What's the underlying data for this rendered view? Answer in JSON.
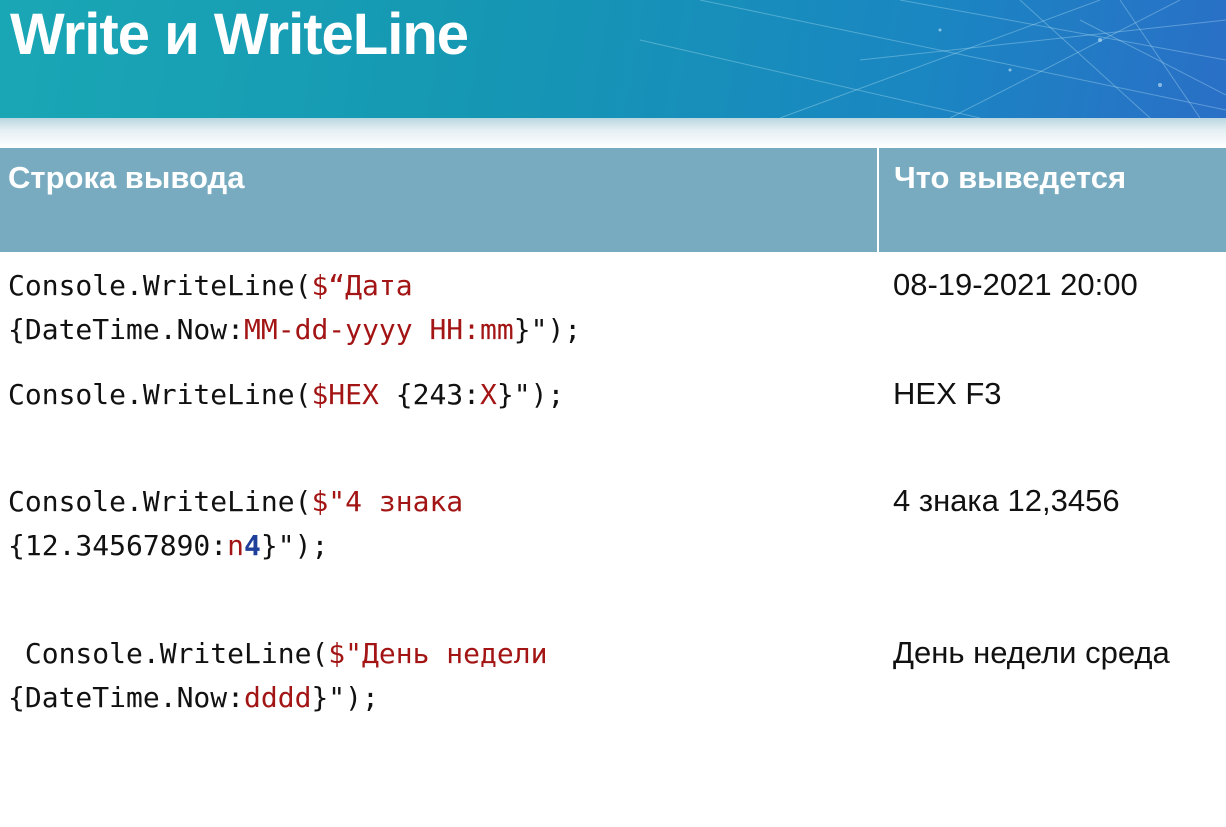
{
  "title": "Write и WriteLine",
  "table": {
    "headers": [
      "Строка вывода",
      "Что выведется"
    ],
    "rows": [
      {
        "code": [
          [
            {
              "t": "Console.WriteLine(",
              "c": ""
            },
            {
              "t": "$“Дата",
              "c": "r"
            }
          ],
          [
            {
              "t": "{DateTime.Now:",
              "c": ""
            },
            {
              "t": "MM-dd-yyyy HH:mm",
              "c": "r"
            },
            {
              "t": "}\");",
              "c": ""
            }
          ]
        ],
        "output": "08-19-2021 20:00"
      },
      {
        "code": [
          [
            {
              "t": "Console.WriteLine(",
              "c": ""
            },
            {
              "t": "$HEX ",
              "c": "r"
            },
            {
              "t": "{243:",
              "c": ""
            },
            {
              "t": "X",
              "c": "r"
            },
            {
              "t": "}\");",
              "c": ""
            }
          ]
        ],
        "output": "HEX F3"
      },
      {
        "code": [
          [
            {
              "t": "Console.WriteLine(",
              "c": ""
            },
            {
              "t": "$\"4 знака",
              "c": "r"
            }
          ],
          [
            {
              "t": "{12.34567890:",
              "c": ""
            },
            {
              "t": "n",
              "c": "r"
            },
            {
              "t": "4",
              "c": "b"
            },
            {
              "t": "}\");",
              "c": ""
            }
          ]
        ],
        "output": "4 знака 12,3456"
      },
      {
        "code": [
          [
            {
              "t": " Console.WriteLine(",
              "c": ""
            },
            {
              "t": "$\"День недели",
              "c": "r"
            }
          ],
          [
            {
              "t": "{DateTime.Now:",
              "c": ""
            },
            {
              "t": "dddd",
              "c": "r"
            },
            {
              "t": "}\");",
              "c": ""
            }
          ]
        ],
        "output": "День недели среда"
      }
    ]
  }
}
